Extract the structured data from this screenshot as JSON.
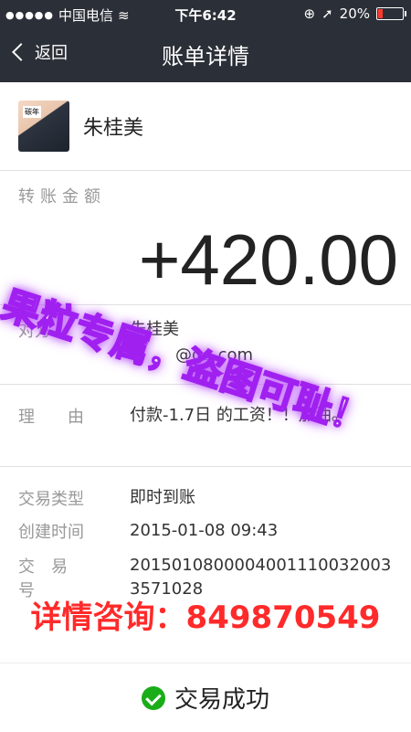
{
  "status": {
    "carrier": "中国电信",
    "time": "下午6:42",
    "battery": "20%"
  },
  "nav": {
    "back_label": "返回",
    "title": "账单详情"
  },
  "profile": {
    "name": "朱桂美"
  },
  "amount": {
    "label": "转账金额",
    "value": "+420.00"
  },
  "details": {
    "recipient_label": "对方",
    "recipient_name": "朱桂美",
    "recipient_email": "@qq.com",
    "reason_label": "理　　由",
    "reason_value": "付款-1.7日        的工资！！加油。",
    "type_label": "交易类型",
    "type_value": "即时到账",
    "time_label": "创建时间",
    "time_value": "2015-01-08 09:43",
    "txid_label": "交易号",
    "txid_value": "20150108000040011100320033571028"
  },
  "footer": {
    "status_text": "交易成功"
  },
  "watermark": {
    "line1": "果粒专属，盗图可耻！",
    "line2": "详情咨询：849870549"
  }
}
